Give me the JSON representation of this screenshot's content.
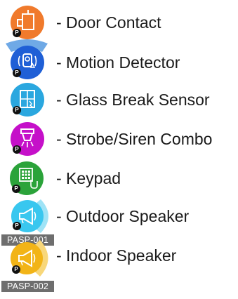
{
  "legend": {
    "items": [
      {
        "label": "- Door Contact",
        "icon": "door-contact-icon",
        "color": "#F07A2C",
        "badge": "P"
      },
      {
        "label": "- Motion Detector",
        "icon": "motion-detector-icon",
        "color": "#1F5FD6",
        "badge": "P"
      },
      {
        "label": "- Glass Break Sensor",
        "icon": "glass-break-sensor-icon",
        "color": "#2AA7DF",
        "badge": "P"
      },
      {
        "label": "- Strobe/Siren Combo",
        "icon": "strobe-siren-icon",
        "color": "#C510C9",
        "badge": "P"
      },
      {
        "label": "- Keypad",
        "icon": "keypad-icon",
        "color": "#2BA33A",
        "badge": "P"
      },
      {
        "label": "- Outdoor Speaker",
        "icon": "outdoor-speaker-icon",
        "color": "#39C7EF",
        "badge": "P",
        "tag": "PASP-001"
      },
      {
        "label": "- Indoor Speaker",
        "icon": "indoor-speaker-icon",
        "color": "#F2B417",
        "badge": "P",
        "tag": "PASP-002"
      }
    ]
  },
  "colors": {
    "motion_fan": "#6FA9E6",
    "outdoor_fan": "#9FE3F6",
    "indoor_fan": "#F8D77A",
    "badge": "#111111",
    "tag_background": "#6E6E6E"
  }
}
